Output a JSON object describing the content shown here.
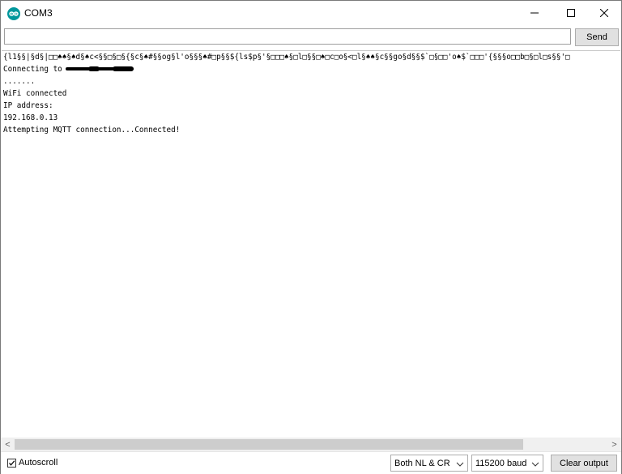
{
  "window": {
    "title": "COM3",
    "minimize_glyph": "—",
    "close_glyph": "✕"
  },
  "input_row": {
    "input_value": "",
    "send_label": "Send"
  },
  "output": {
    "garbled_line": "{l1§§|§d§|□□♠♠§♠d§♠c<§§□§□§{§c§♠#§§og§l'o§§§♠#□p§§${ls$p§'§□□□♠§□l□§§□♠□c□o§<□l§♠♠§c§§go§d§§$`□§□□'o♠$`□□□'{§§§o□□b□§□l□s§§'□",
    "connecting_prefix": "Connecting to",
    "lines": [
      ".......",
      "WiFi connected",
      "IP address:",
      "192.168.0.13",
      "Attempting MQTT connection...Connected!"
    ]
  },
  "scrollbar": {
    "left_arrow": "<",
    "right_arrow": ">"
  },
  "bottombar": {
    "autoscroll_label": "Autoscroll",
    "autoscroll_checked": true,
    "line_ending_value": "Both NL & CR",
    "baud_value": "115200 baud",
    "clear_label": "Clear output"
  },
  "colors": {
    "accent": "#0078d7",
    "arduino_teal": "#00979c"
  },
  "icons": {
    "app": "arduino-logo-icon",
    "minimize": "minimize-icon",
    "maximize": "maximize-icon",
    "close": "close-icon",
    "checkbox": "checkmark-icon",
    "dropdown": "chevron-down-icon"
  }
}
